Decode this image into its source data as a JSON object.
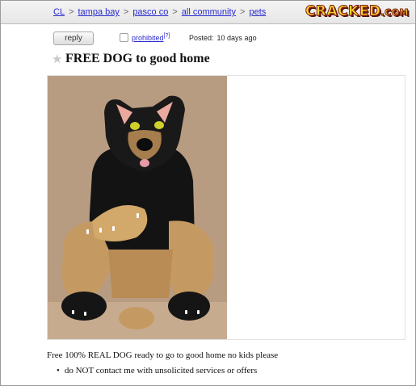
{
  "breadcrumb": {
    "items": [
      "CL",
      "tampa bay",
      "pasco co",
      "all community",
      "pets"
    ],
    "separator": ">"
  },
  "logo": {
    "text": "CRACKED",
    "suffix": ".COM"
  },
  "postbar": {
    "reply_label": "reply",
    "prohibited_label": "prohibited",
    "prohibited_sup": "[?]",
    "posted_label": "Posted:",
    "posted_value": "10 days ago"
  },
  "post": {
    "title": "FREE DOG to good home",
    "body": "Free 100% REAL DOG ready to go to good home no kids please",
    "bullets": [
      "do NOT contact me with unsolicited services or offers"
    ]
  },
  "icons": {
    "star": "star-icon",
    "checkbox": "checkbox-icon"
  },
  "colors": {
    "link": "#2a2ad0",
    "logo_fill": "#ffd52b",
    "logo_stroke": "#7a1c12"
  }
}
